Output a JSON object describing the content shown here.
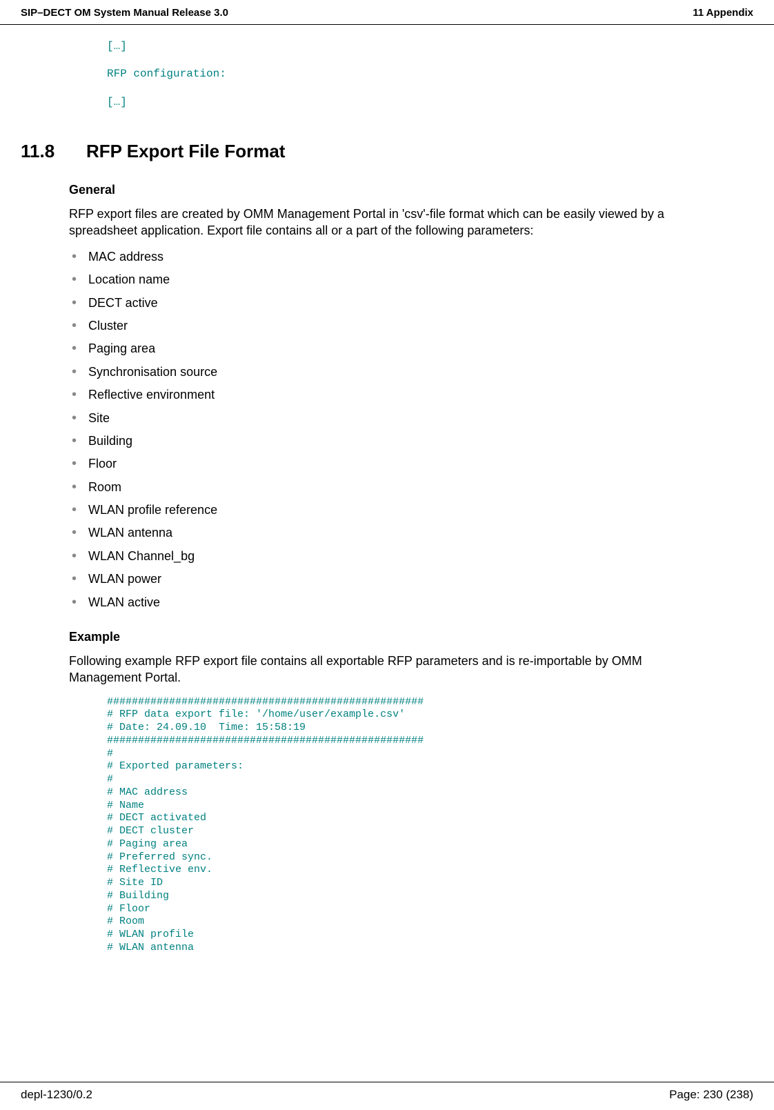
{
  "header": {
    "left": "SIP–DECT OM System Manual Release 3.0",
    "right": "11 Appendix"
  },
  "intro_code": [
    "[…]",
    "RFP configuration:",
    "[…]"
  ],
  "section": {
    "number": "11.8",
    "title": "RFP Export File Format"
  },
  "general": {
    "heading": "General",
    "paragraph": "RFP export files are created by OMM Management Portal in 'csv'-file format which can be easily viewed by a spreadsheet application. Export file contains all or a part of the following parameters:",
    "bullets": [
      "MAC address",
      "Location name",
      "DECT active",
      "Cluster",
      "Paging area",
      "Synchronisation source",
      "Reflective environment",
      "Site",
      "Building",
      "Floor",
      "Room",
      "WLAN profile reference",
      "WLAN antenna",
      "WLAN Channel_bg",
      "WLAN power",
      "WLAN active"
    ]
  },
  "example": {
    "heading": "Example",
    "paragraph": "Following example RFP export file contains all exportable RFP parameters and is re-importable by OMM Management Portal.",
    "code": "###################################################\n# RFP data export file: '/home/user/example.csv'\n# Date: 24.09.10  Time: 15:58:19\n###################################################\n#\n# Exported parameters:\n#\n# MAC address\n# Name\n# DECT activated\n# DECT cluster\n# Paging area\n# Preferred sync.\n# Reflective env.\n# Site ID\n# Building\n# Floor\n# Room\n# WLAN profile\n# WLAN antenna"
  },
  "footer": {
    "left": "depl-1230/0.2",
    "right": "Page: 230 (238)"
  }
}
